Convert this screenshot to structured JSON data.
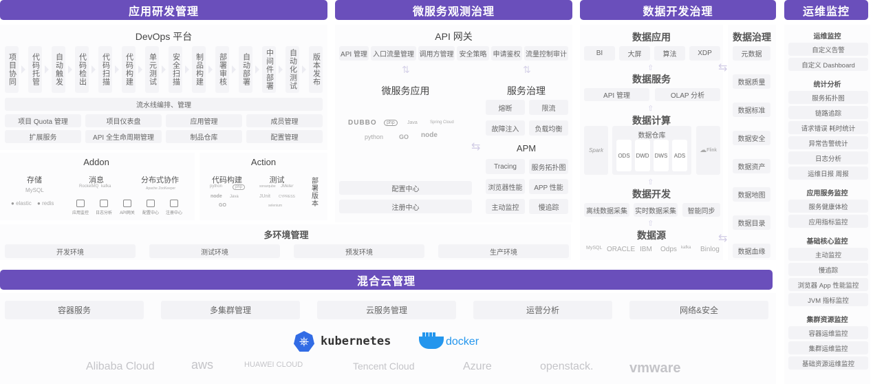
{
  "colors": {
    "accent": "#6a4fbb",
    "box": "#f3f3f6",
    "text": "#666666"
  },
  "headers": {
    "app_dev": "应用研发管理",
    "microservice": "微服务观测治理",
    "data_dev": "数据开发治理",
    "ops": "运维监控",
    "hybrid_cloud": "混合云管理"
  },
  "devops": {
    "title": "DevOps 平台",
    "pipeline_steps": [
      "项目协同",
      "代码托管",
      "自动触发",
      "代码检出",
      "代码扫描",
      "代码构建",
      "单元测试",
      "安全扫描",
      "制品构建",
      "部署审核",
      "自动部署",
      "中间件部署",
      "自动化测试",
      "版本发布"
    ],
    "pipeline_label": "流水线编排、管理",
    "grid": [
      [
        "项目 Quota 管理",
        "项目仪表盘",
        "应用管理",
        "成员管理"
      ],
      [
        "扩展服务",
        "API 全生命周期管理",
        "制品仓库",
        "配置管理"
      ]
    ]
  },
  "addon": {
    "title": "Addon",
    "storage": {
      "label": "存储",
      "logos": [
        "MySQL",
        "elastic",
        "redis"
      ]
    },
    "message": {
      "label": "消息",
      "logos": [
        "RocketMQ",
        "kafka"
      ]
    },
    "distributed": {
      "label": "分布式协作",
      "logos": [
        "Apache ZooKeeper"
      ]
    },
    "tools": [
      "应用监控",
      "日志分析",
      "API网关",
      "配置中心",
      "注册中心"
    ]
  },
  "action": {
    "title": "Action",
    "build": {
      "label": "代码构建",
      "logos": [
        "python",
        "php",
        "node",
        "Java",
        "GO"
      ]
    },
    "test": {
      "label": "测试",
      "logos": [
        "sonarqube",
        "JMeter",
        "JUnit",
        "CYPRESS",
        "selenium"
      ]
    },
    "deploy": "部署版本"
  },
  "env": {
    "title": "多环境管理",
    "items": [
      "开发环境",
      "测试环境",
      "预发环境",
      "生产环境"
    ]
  },
  "gateway": {
    "title": "API 网关",
    "items": [
      "API 管理",
      "入口流量管理",
      "调用方管理",
      "安全策略",
      "申请鉴权",
      "流量控制审计"
    ]
  },
  "ms_app": {
    "title": "微服务应用",
    "logos": [
      "DUBBO",
      "php",
      "Java",
      "Spring Cloud",
      "python",
      "GO",
      "node"
    ],
    "items": [
      "配置中心",
      "注册中心"
    ]
  },
  "governance": {
    "title": "服务治理",
    "items": [
      "熔断",
      "限流",
      "故障注入",
      "负载均衡"
    ]
  },
  "apm": {
    "title": "APM",
    "items": [
      "Tracing",
      "服务拓扑图",
      "浏览器性能",
      "APP 性能",
      "主动监控",
      "慢追踪"
    ]
  },
  "data_app": {
    "title": "数据应用",
    "items": [
      "BI",
      "大屏",
      "算法",
      "XDP"
    ]
  },
  "data_service": {
    "title": "数据服务",
    "items": [
      "API 管理",
      "OLAP 分析"
    ]
  },
  "data_compute": {
    "title": "数据计算",
    "spark": "Spark",
    "warehouse": "数据仓库",
    "layers": [
      "ODS",
      "DWD",
      "DWS",
      "ADS"
    ],
    "flink": "Flink"
  },
  "data_develop": {
    "title": "数据开发",
    "items": [
      "离线数据采集",
      "实时数据采集",
      "智能同步"
    ]
  },
  "data_source": {
    "title": "数据源",
    "logos": [
      "MySQL",
      "ORACLE",
      "IBM",
      "Odps",
      "kafka",
      "Binlog"
    ]
  },
  "data_gov": {
    "title": "数据治理",
    "items": [
      "元数据",
      "数据质量",
      "数据标准",
      "数据安全",
      "数据资产",
      "数据地图",
      "数据目录",
      "数据血缘"
    ]
  },
  "ops": {
    "groups": [
      {
        "title": "运维监控",
        "items": [
          "自定义告警",
          "自定义 Dashboard"
        ]
      },
      {
        "title": "统计分析",
        "items": [
          "服务拓扑图",
          "链路追踪",
          "请求错误 耗时统计",
          "异常告警统计",
          "日志分析",
          "运维日报 周报"
        ]
      },
      {
        "title": "应用服务监控",
        "items": [
          "服务健康体检",
          "应用指标监控"
        ]
      },
      {
        "title": "基础核心监控",
        "items": [
          "主动监控",
          "慢追踪",
          "浏览器 App 性能监控",
          "JVM 指标监控"
        ]
      },
      {
        "title": "集群资源监控",
        "items": [
          "容器运维监控",
          "集群运维监控",
          "基础资源运维监控"
        ]
      }
    ]
  },
  "cloud": {
    "items": [
      "容器服务",
      "多集群管理",
      "云服务管理",
      "运营分析",
      "网络&安全"
    ],
    "runtimes": [
      "kubernetes",
      "docker"
    ],
    "providers": [
      "Alibaba Cloud",
      "aws",
      "HUAWEI CLOUD",
      "Tencent Cloud",
      "Azure",
      "openstack.",
      "vmware"
    ]
  }
}
